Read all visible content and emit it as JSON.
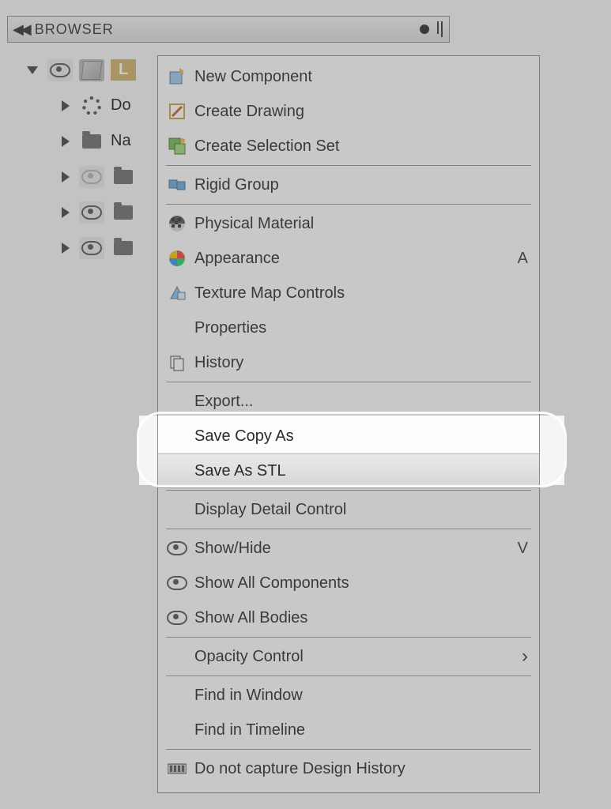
{
  "browser": {
    "title": "BROWSER"
  },
  "tree": {
    "root_label": "L",
    "items": [
      {
        "label": "Do"
      },
      {
        "label": "Na"
      },
      {
        "label": ""
      },
      {
        "label": ""
      },
      {
        "label": ""
      }
    ]
  },
  "menu": {
    "items": [
      {
        "label": "New Component"
      },
      {
        "label": "Create Drawing"
      },
      {
        "label": "Create Selection Set"
      },
      {
        "label": "Rigid Group"
      },
      {
        "label": "Physical Material"
      },
      {
        "label": "Appearance",
        "shortcut": "A"
      },
      {
        "label": "Texture Map Controls"
      },
      {
        "label": "Properties"
      },
      {
        "label": "History"
      },
      {
        "label": "Export..."
      },
      {
        "label": "Save Copy As"
      },
      {
        "label": "Save As STL"
      },
      {
        "label": "Display Detail Control"
      },
      {
        "label": "Show/Hide",
        "shortcut": "V"
      },
      {
        "label": "Show All Components"
      },
      {
        "label": "Show All Bodies"
      },
      {
        "label": "Opacity Control",
        "submenu": true
      },
      {
        "label": "Find in Window"
      },
      {
        "label": "Find in Timeline"
      },
      {
        "label": "Do not capture Design History"
      }
    ]
  }
}
